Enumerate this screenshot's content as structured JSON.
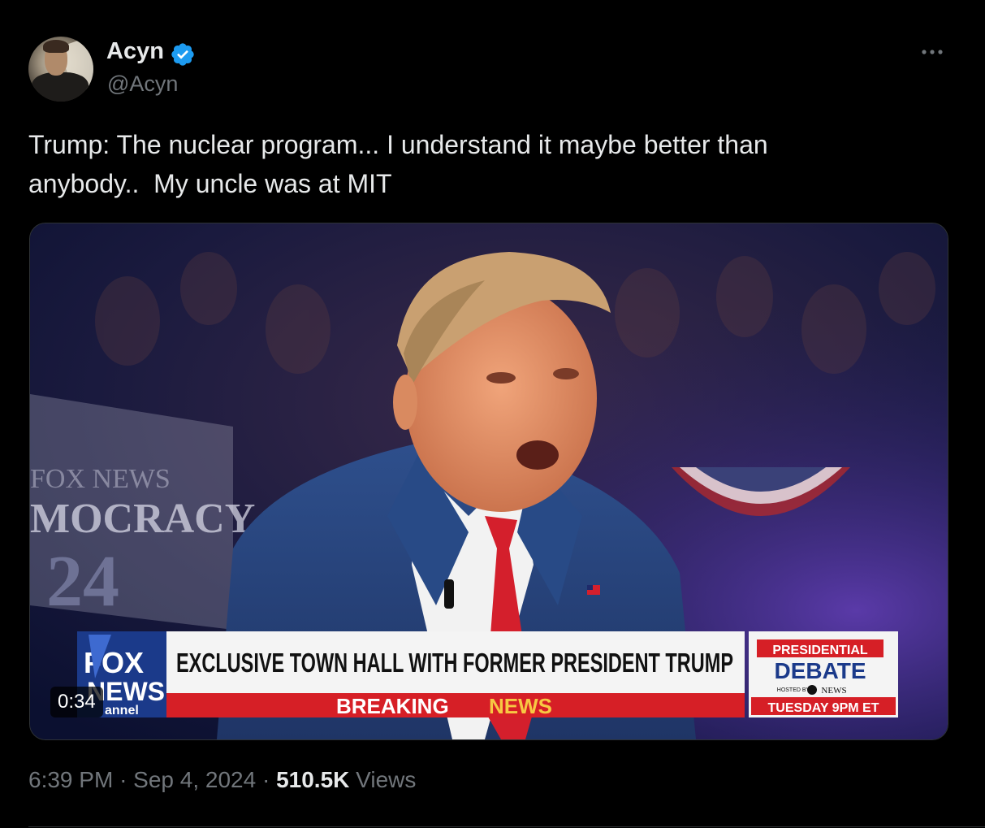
{
  "author": {
    "name": "Acyn",
    "handle": "@Acyn",
    "verified": true
  },
  "tweet": {
    "text_lines": [
      "Trump: The nuclear program... I understand it maybe better than",
      "anybody..  My uncle was at MIT"
    ]
  },
  "video": {
    "duration": "0:34",
    "lower_third": {
      "headline": "EXCLUSIVE TOWN HALL WITH FORMER PRESIDENT TRUMP",
      "ticker_word1": "BREAKING",
      "ticker_word2": "NEWS",
      "logo_top": "FOX",
      "logo_middle": "NEWS",
      "logo_bottom": "annel",
      "promo_title": "PRESIDENTIAL",
      "promo_subtitle": "DEBATE",
      "promo_hosted": "HOSTED BY",
      "promo_network": "NEWS",
      "promo_time": "TUESDAY 9PM ET"
    },
    "background_text": {
      "line1": "FOX NEWS",
      "line2": "MOCRACY",
      "line3": "24"
    }
  },
  "meta": {
    "time": "6:39 PM",
    "separator1": "·",
    "date": "Sep 4, 2024",
    "separator2": "·",
    "views_count": "510.5K",
    "views_label": "Views"
  },
  "colors": {
    "background": "#000000",
    "text_primary": "#e7e9ea",
    "text_secondary": "#71767b",
    "verified_blue": "#1d9bf0",
    "fox_red": "#d61f26",
    "fox_blue": "#1b3a8a"
  },
  "icons": [
    "verified-badge-icon",
    "more-options-icon"
  ]
}
